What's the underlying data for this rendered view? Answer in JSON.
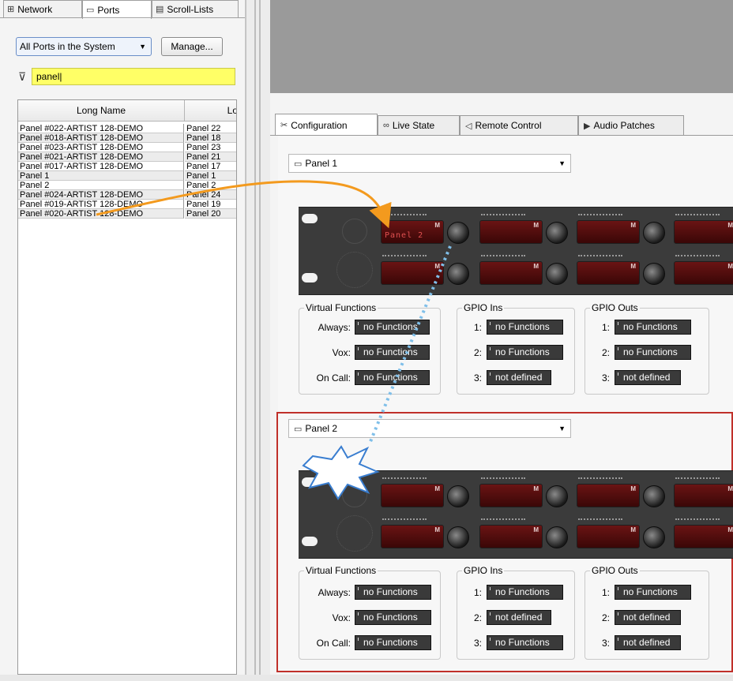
{
  "left_tabs": [
    {
      "label": "Network",
      "icon": "network-icon"
    },
    {
      "label": "Ports",
      "icon": "ports-icon"
    },
    {
      "label": "Scroll-Lists",
      "icon": "scroll-list-icon"
    }
  ],
  "ports_filter": {
    "selected": "All Ports in the System",
    "manage_label": "Manage...",
    "filter_value": "panel"
  },
  "table": {
    "columns": [
      "Long Name",
      "Lo"
    ],
    "rows": [
      {
        "long": "Panel #022-ARTIST 128-DEMO",
        "short": "Panel 22"
      },
      {
        "long": "Panel #018-ARTIST 128-DEMO",
        "short": "Panel 18"
      },
      {
        "long": "Panel #023-ARTIST 128-DEMO",
        "short": "Panel 23"
      },
      {
        "long": "Panel #021-ARTIST 128-DEMO",
        "short": "Panel 21"
      },
      {
        "long": "Panel #017-ARTIST 128-DEMO",
        "short": "Panel 17"
      },
      {
        "long": "Panel 1",
        "short": "Panel 1"
      },
      {
        "long": "Panel 2",
        "short": "Panel 2"
      },
      {
        "long": "Panel #024-ARTIST 128-DEMO",
        "short": "Panel 24"
      },
      {
        "long": "Panel #019-ARTIST 128-DEMO",
        "short": "Panel 19"
      },
      {
        "long": "Panel #020-ARTIST 128-DEMO",
        "short": "Panel 20"
      }
    ]
  },
  "right_tabs": [
    {
      "label": "Configuration",
      "icon": "tools-icon"
    },
    {
      "label": "Live State",
      "icon": "glasses-icon"
    },
    {
      "label": "Remote Control",
      "icon": "remote-icon"
    },
    {
      "label": "Audio Patches",
      "icon": "patch-icon"
    }
  ],
  "panel1": {
    "selector": "Panel 1",
    "display_text": "Panel 2",
    "virtual_functions": {
      "title": "Virtual Functions",
      "always_label": "Always:",
      "always": "no Functions",
      "vox_label": "Vox:",
      "vox": "no Functions",
      "oncall_label": "On Call:",
      "oncall": "no Functions"
    },
    "gpio_ins": {
      "title": "GPIO Ins",
      "items": [
        {
          "n": "1:",
          "v": "no Functions"
        },
        {
          "n": "2:",
          "v": "no Functions"
        },
        {
          "n": "3:",
          "v": "not defined"
        }
      ]
    },
    "gpio_outs": {
      "title": "GPIO Outs",
      "items": [
        {
          "n": "1:",
          "v": "no Functions"
        },
        {
          "n": "2:",
          "v": "no Functions"
        },
        {
          "n": "3:",
          "v": "not defined"
        }
      ]
    }
  },
  "panel2": {
    "selector": "Panel 2",
    "virtual_functions": {
      "title": "Virtual Functions",
      "always_label": "Always:",
      "always": "no Functions",
      "vox_label": "Vox:",
      "vox": "no Functions",
      "oncall_label": "On Call:",
      "oncall": "no Functions"
    },
    "gpio_ins": {
      "title": "GPIO Ins",
      "items": [
        {
          "n": "1:",
          "v": "no Functions"
        },
        {
          "n": "2:",
          "v": "not defined"
        },
        {
          "n": "3:",
          "v": "no Functions"
        }
      ]
    },
    "gpio_outs": {
      "title": "GPIO Outs",
      "items": [
        {
          "n": "1:",
          "v": "no Functions"
        },
        {
          "n": "2:",
          "v": "not defined"
        },
        {
          "n": "3:",
          "v": "not defined"
        }
      ]
    }
  },
  "led_marker": "M",
  "colors": {
    "filter_bg": "#ffff66",
    "arrow_orange": "#f39a1e",
    "arrow_blue": "#7fbfe9",
    "highlight_frame": "#c0302a",
    "led_red": "#5a0f0f"
  }
}
